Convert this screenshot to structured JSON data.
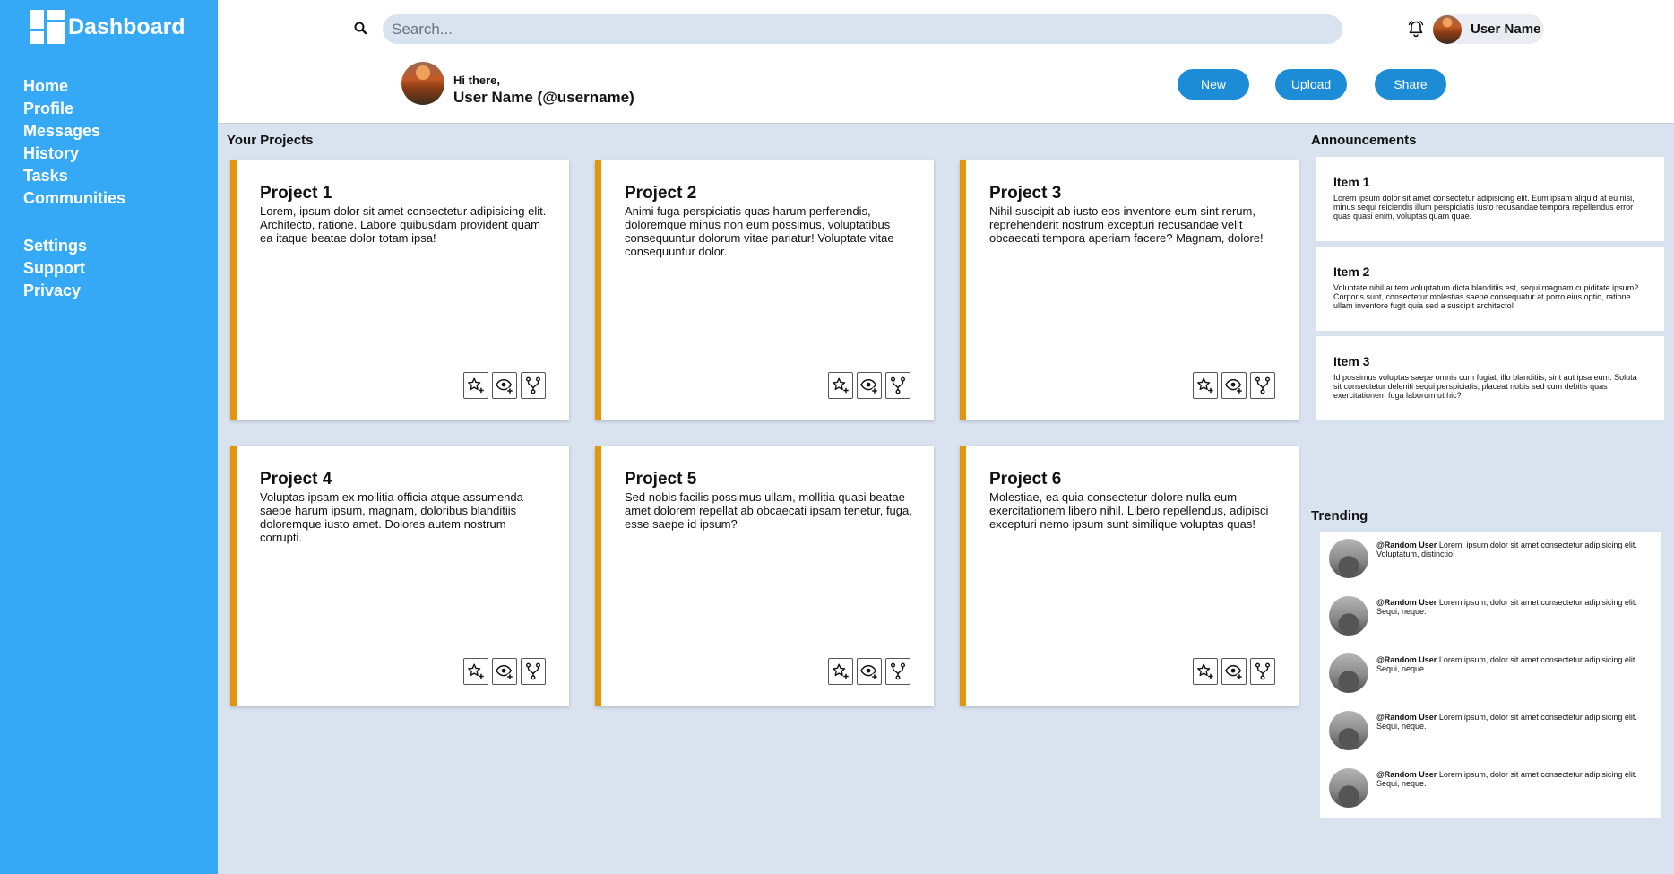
{
  "app": {
    "title": "Dashboard"
  },
  "sidebar": {
    "primary": [
      {
        "label": "Home"
      },
      {
        "label": "Profile"
      },
      {
        "label": "Messages"
      },
      {
        "label": "History"
      },
      {
        "label": "Tasks"
      },
      {
        "label": "Communities"
      }
    ],
    "secondary": [
      {
        "label": "Settings"
      },
      {
        "label": "Support"
      },
      {
        "label": "Privacy"
      }
    ]
  },
  "header": {
    "search": {
      "placeholder": "Search...",
      "value": ""
    },
    "user_name": "User Name",
    "greeting": "Hi there,",
    "display_name": "User Name (@username)",
    "buttons": {
      "new": "New",
      "upload": "Upload",
      "share": "Share"
    }
  },
  "projects": {
    "heading": "Your Projects",
    "items": [
      {
        "title": "Project 1",
        "description": "Lorem, ipsum dolor sit amet consectetur adipisicing elit. Architecto, ratione. Labore quibusdam provident quam ea itaque beatae dolor totam ipsa!"
      },
      {
        "title": "Project 2",
        "description": "Animi fuga perspiciatis quas harum perferendis, doloremque minus non eum possimus, voluptatibus consequuntur dolorum vitae pariatur! Voluptate vitae consequuntur dolor."
      },
      {
        "title": "Project 3",
        "description": "Nihil suscipit ab iusto eos inventore eum sint rerum, reprehenderit nostrum excepturi recusandae velit obcaecati tempora aperiam facere? Magnam, dolore!"
      },
      {
        "title": "Project 4",
        "description": "Voluptas ipsam ex mollitia officia atque assumenda saepe harum ipsum, magnam, doloribus blanditiis doloremque iusto amet. Dolores autem nostrum corrupti."
      },
      {
        "title": "Project 5",
        "description": "Sed nobis facilis possimus ullam, mollitia quasi beatae amet dolorem repellat ab obcaecati ipsam tenetur, fuga, esse saepe id ipsum?"
      },
      {
        "title": "Project 6",
        "description": "Molestiae, ea quia consectetur dolore nulla eum exercitationem libero nihil. Libero repellendus, adipisci excepturi nemo ipsum sunt similique voluptas quas!"
      }
    ],
    "actions": [
      "star-plus-icon",
      "eye-plus-icon",
      "fork-icon"
    ]
  },
  "announcements": {
    "heading": "Announcements",
    "items": [
      {
        "title": "Item 1",
        "text": "Lorem ipsum dolor sit amet consectetur adipisicing elit. Eum ipsam aliquid at eu nisi, minus sequi reiciendis illum perspiciatis iusto recusandae tempora repellendus error quas quasi enim, voluptas quam quae."
      },
      {
        "title": "Item 2",
        "text": "Voluptate nihil autem voluptatum dicta blanditiis est, sequi magnam cupiditate ipsum? Corporis sunt, consectetur molestias saepe consequatur at porro eius optio, ratione ullam inventore fugit quia sed a suscipit architecto!"
      },
      {
        "title": "Item 3",
        "text": "Id possimus voluptas saepe omnis cum fugiat, illo blanditiis, sint aut ipsa eum. Soluta sit consectetur deleniti sequi perspiciatis, placeat nobis sed cum debitis quas exercitationem fuga laborum ut hic?"
      }
    ]
  },
  "trending": {
    "heading": "Trending",
    "items": [
      {
        "user": "@Random User",
        "text": "Lorem, ipsum dolor sit amet consectetur adipisicing elit. Voluptatum, distinctio!"
      },
      {
        "user": "@Random User",
        "text": "Lorem ipsum, dolor sit amet consectetur adipisicing elit. Sequi, neque."
      },
      {
        "user": "@Random User",
        "text": "Lorem ipsum, dolor sit amet consectetur adipisicing elit. Sequi, neque."
      },
      {
        "user": "@Random User",
        "text": "Lorem ipsum, dolor sit amet consectetur adipisicing elit. Sequi, neque."
      },
      {
        "user": "@Random User",
        "text": "Lorem ipsum, dolor sit amet consectetur adipisicing elit. Sequi, neque."
      }
    ]
  },
  "colors": {
    "sidebar": "#35a9f6",
    "background": "#d9e3ef",
    "button": "#1b8cd5",
    "card_accent": "#e2960d"
  }
}
